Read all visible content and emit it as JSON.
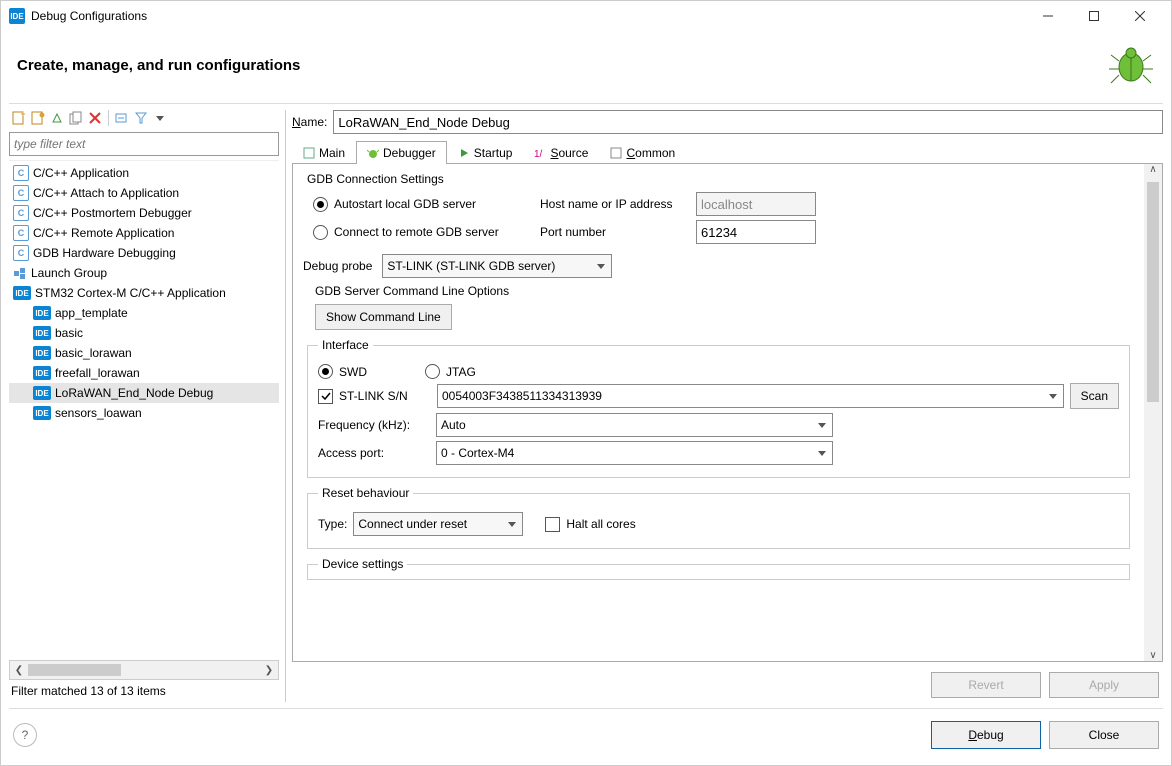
{
  "window": {
    "app_icon_label": "IDE",
    "title": "Debug Configurations"
  },
  "header": {
    "title": "Create, manage, and run configurations"
  },
  "left": {
    "filter_placeholder": "type filter text",
    "tree": [
      {
        "icon": "c",
        "label": "C/C++ Application"
      },
      {
        "icon": "c",
        "label": "C/C++ Attach to Application"
      },
      {
        "icon": "c",
        "label": "C/C++ Postmortem Debugger"
      },
      {
        "icon": "c",
        "label": "C/C++ Remote Application"
      },
      {
        "icon": "c",
        "label": "GDB Hardware Debugging"
      },
      {
        "icon": "launch",
        "label": "Launch Group"
      },
      {
        "icon": "ide",
        "label": "STM32 Cortex-M C/C++ Application"
      },
      {
        "icon": "ide",
        "label": "app_template",
        "depth": 1
      },
      {
        "icon": "ide",
        "label": "basic",
        "depth": 1
      },
      {
        "icon": "ide",
        "label": "basic_lorawan",
        "depth": 1
      },
      {
        "icon": "ide",
        "label": "freefall_lorawan",
        "depth": 1
      },
      {
        "icon": "ide",
        "label": "LoRaWAN_End_Node Debug",
        "depth": 1,
        "selected": true
      },
      {
        "icon": "ide",
        "label": "sensors_loawan",
        "depth": 1
      }
    ],
    "filter_status": "Filter matched 13 of 13 items"
  },
  "right": {
    "name_label": "Name:",
    "name_value": "LoRaWAN_End_Node Debug",
    "tabs": {
      "main": "Main",
      "debugger": "Debugger",
      "startup": "Startup",
      "source": "Source",
      "common": "Common"
    },
    "gdb": {
      "section": "GDB Connection Settings",
      "autostart_label": "Autostart local GDB server",
      "connect_remote_label": "Connect to remote GDB server",
      "host_label": "Host name or IP address",
      "host_value": "localhost",
      "port_label": "Port number",
      "port_value": "61234"
    },
    "debug_probe": {
      "label": "Debug probe",
      "value": "ST-LINK (ST-LINK GDB server)"
    },
    "cmdline": {
      "section": "GDB Server Command Line Options",
      "show_btn": "Show Command Line"
    },
    "interface": {
      "legend": "Interface",
      "swd": "SWD",
      "jtag": "JTAG",
      "stlink_sn_label": "ST-LINK S/N",
      "stlink_sn_value": "0054003F3438511334313939",
      "scan_btn": "Scan",
      "freq_label": "Frequency (kHz):",
      "freq_value": "Auto",
      "access_port_label": "Access port:",
      "access_port_value": "0 - Cortex-M4"
    },
    "reset": {
      "legend": "Reset behaviour",
      "type_label": "Type:",
      "type_value": "Connect under reset",
      "halt_label": "Halt all cores"
    },
    "device": {
      "legend": "Device settings"
    },
    "buttons": {
      "revert": "Revert",
      "apply": "Apply"
    }
  },
  "footer": {
    "debug": "Debug",
    "close": "Close"
  }
}
